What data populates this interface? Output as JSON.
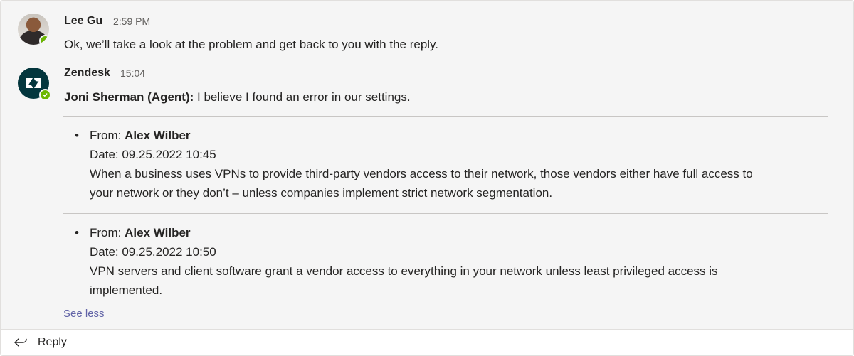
{
  "messages": [
    {
      "author": "Lee Gu",
      "time": "2:59 PM",
      "avatar": "person-photo",
      "presence": "available",
      "text": "Ok, we’ll take a look at the problem and get back to you with the reply."
    },
    {
      "author": "Zendesk",
      "time": "15:04",
      "avatar": "zendesk-logo-icon",
      "presence": "available",
      "agent_label": "Joni Sherman (Agent):",
      "text": " I believe I found an error in our settings.",
      "items": [
        {
          "from_label": "From: ",
          "from": "Alex Wilber",
          "date": "Date: 09.25.2022 10:45",
          "line1": "When a business uses VPNs to provide third-party vendors access to their network, those vendors either have full access to",
          "line2": "your network or they don’t – unless companies implement strict network segmentation."
        },
        {
          "from_label": "From: ",
          "from": "Alex Wilber",
          "date": "Date: 09.25.2022 10:50",
          "line1": "VPN servers and client software grant a vendor access to everything in your network unless least privileged access is",
          "line2": "implemented."
        }
      ],
      "see_less": "See less"
    }
  ],
  "reply": {
    "label": "Reply",
    "icon": "reply-arrow-icon"
  },
  "colors": {
    "presence": "#6bb700",
    "zendesk": "#03363d",
    "link": "#6264a7"
  }
}
